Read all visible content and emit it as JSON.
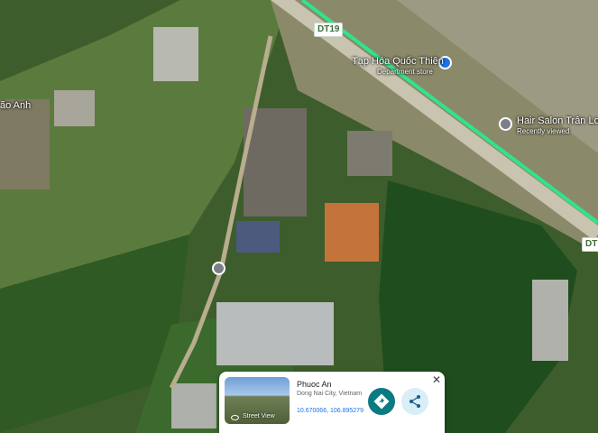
{
  "map": {
    "road_label_top": "DT19",
    "road_label_right": "DT1",
    "places": [
      {
        "name": "Tạp Hóa Quốc Thiện",
        "category": "Department store"
      },
      {
        "name": "Hair Salon Trân Lon",
        "status": "Recently viewed"
      }
    ],
    "left_edge_label": "ão Anh",
    "colors": {
      "road": "#2ee58c",
      "pin": "#7b7f86",
      "shop_pin": "#1a73e8"
    }
  },
  "card": {
    "title": "Phuoc An",
    "subtitle": "Dong Nai City, Vietnam",
    "coordinates": "10.670066, 106.895279",
    "thumbnail_label": "Street View",
    "close_glyph": "✕"
  }
}
